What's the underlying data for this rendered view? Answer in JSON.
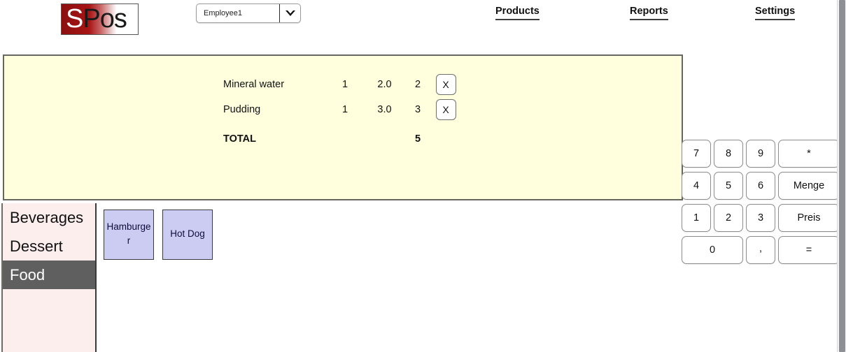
{
  "header": {
    "logo": {
      "primary": "S",
      "secondary": "Pos",
      "bg_color": "#a81414"
    },
    "employee_select": {
      "value": "Employee1",
      "arrow_icon": "chevron-down-icon"
    },
    "nav": [
      {
        "label": "Products"
      },
      {
        "label": "Reports"
      },
      {
        "label": "Settings"
      }
    ]
  },
  "receipt": {
    "bg_color": "#ffffdd",
    "columns": [
      "name",
      "quantity",
      "price",
      "sum",
      "delete"
    ],
    "rows": [
      {
        "name": "Mineral water",
        "quantity": "1",
        "price": "2.0",
        "sum": "2",
        "delete_label": "X"
      },
      {
        "name": "Pudding",
        "quantity": "1",
        "price": "3.0",
        "sum": "3",
        "delete_label": "X"
      }
    ],
    "total": {
      "label": "TOTAL",
      "value": "5"
    }
  },
  "categories": {
    "selected": "Food",
    "items": [
      {
        "label": "Beverages"
      },
      {
        "label": "Dessert"
      },
      {
        "label": "Food"
      }
    ]
  },
  "products": {
    "items": [
      {
        "label": "Hamburger"
      },
      {
        "label": "Hot Dog"
      }
    ]
  },
  "numpad": {
    "keys": [
      {
        "label": "7"
      },
      {
        "label": "8"
      },
      {
        "label": "9"
      },
      {
        "label": "*"
      },
      {
        "label": "4"
      },
      {
        "label": "5"
      },
      {
        "label": "6"
      },
      {
        "label": "Menge"
      },
      {
        "label": "1"
      },
      {
        "label": "2"
      },
      {
        "label": "3"
      },
      {
        "label": "Preis"
      },
      {
        "label": "0"
      },
      {
        "label": ","
      },
      {
        "label": "="
      }
    ]
  }
}
